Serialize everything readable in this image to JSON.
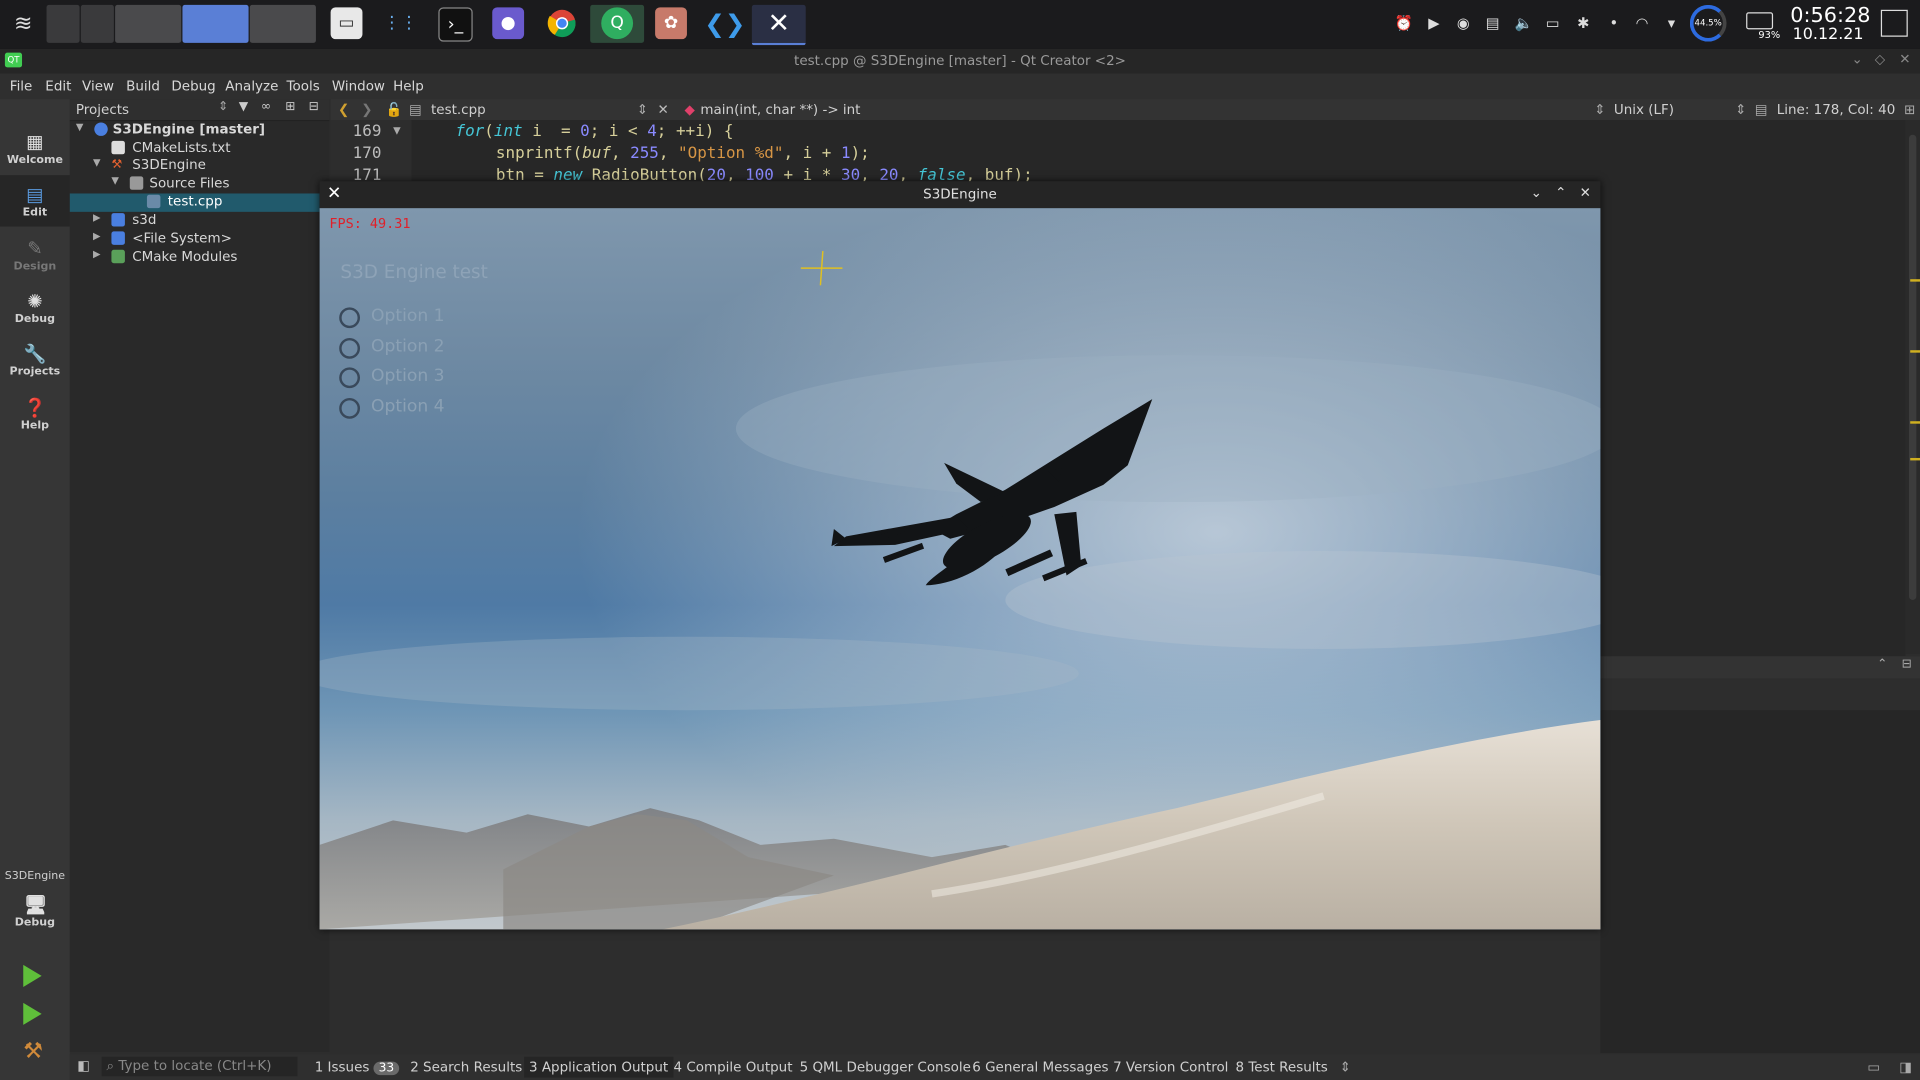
{
  "window": {
    "title": "test.cpp @ S3DEngine [master] - Qt Creator <2>"
  },
  "taskbar": {
    "clock_time": "0:56:28",
    "clock_date": "10.12.21",
    "cpu_label": "44.5%",
    "battery_label": "93%"
  },
  "menu": [
    "File",
    "Edit",
    "View",
    "Build",
    "Debug",
    "Analyze",
    "Tools",
    "Window",
    "Help"
  ],
  "modes": {
    "welcome": "Welcome",
    "edit": "Edit",
    "design": "Design",
    "debug": "Debug",
    "projects": "Projects",
    "help": "Help",
    "kit_name": "S3DEngine",
    "kit_mode": "Debug"
  },
  "projects": {
    "header": "Projects",
    "tree": {
      "root": "S3DEngine [master]",
      "cmakelists": "CMakeLists.txt",
      "s3dengine": "S3DEngine",
      "source_files": "Source Files",
      "test_cpp": "test.cpp",
      "s3d": "s3d",
      "file_system": "<File System>",
      "cmake_modules": "CMake Modules"
    }
  },
  "editor": {
    "file_tab": "test.cpp",
    "symbol": "main(int, char **) -> int",
    "line_ending": "Unix (LF)",
    "cursor": "Line: 178, Col: 40",
    "lines": {
      "n169": "169",
      "n170": "170",
      "n171": "171"
    }
  },
  "statusbar": {
    "locate_placeholder": "Type to locate (Ctrl+K)",
    "issues_label": "1  Issues",
    "issues_count": "33",
    "search": "2  Search Results",
    "app_output": "3  Application Output",
    "compile": "4  Compile Output",
    "qml": "5  QML Debugger Console",
    "general": "6  General Messages",
    "vcs": "7  Version Control",
    "tests": "8  Test Results"
  },
  "s3d": {
    "title": "S3DEngine",
    "fps": "FPS: 49.31",
    "engine_title": "S3D Engine test",
    "options": [
      "Option 1",
      "Option 2",
      "Option 3",
      "Option 4"
    ]
  },
  "colors": {
    "accent_selection": "#215a6c",
    "fps_text": "#e0202a",
    "crosshair": "#e0c020"
  }
}
